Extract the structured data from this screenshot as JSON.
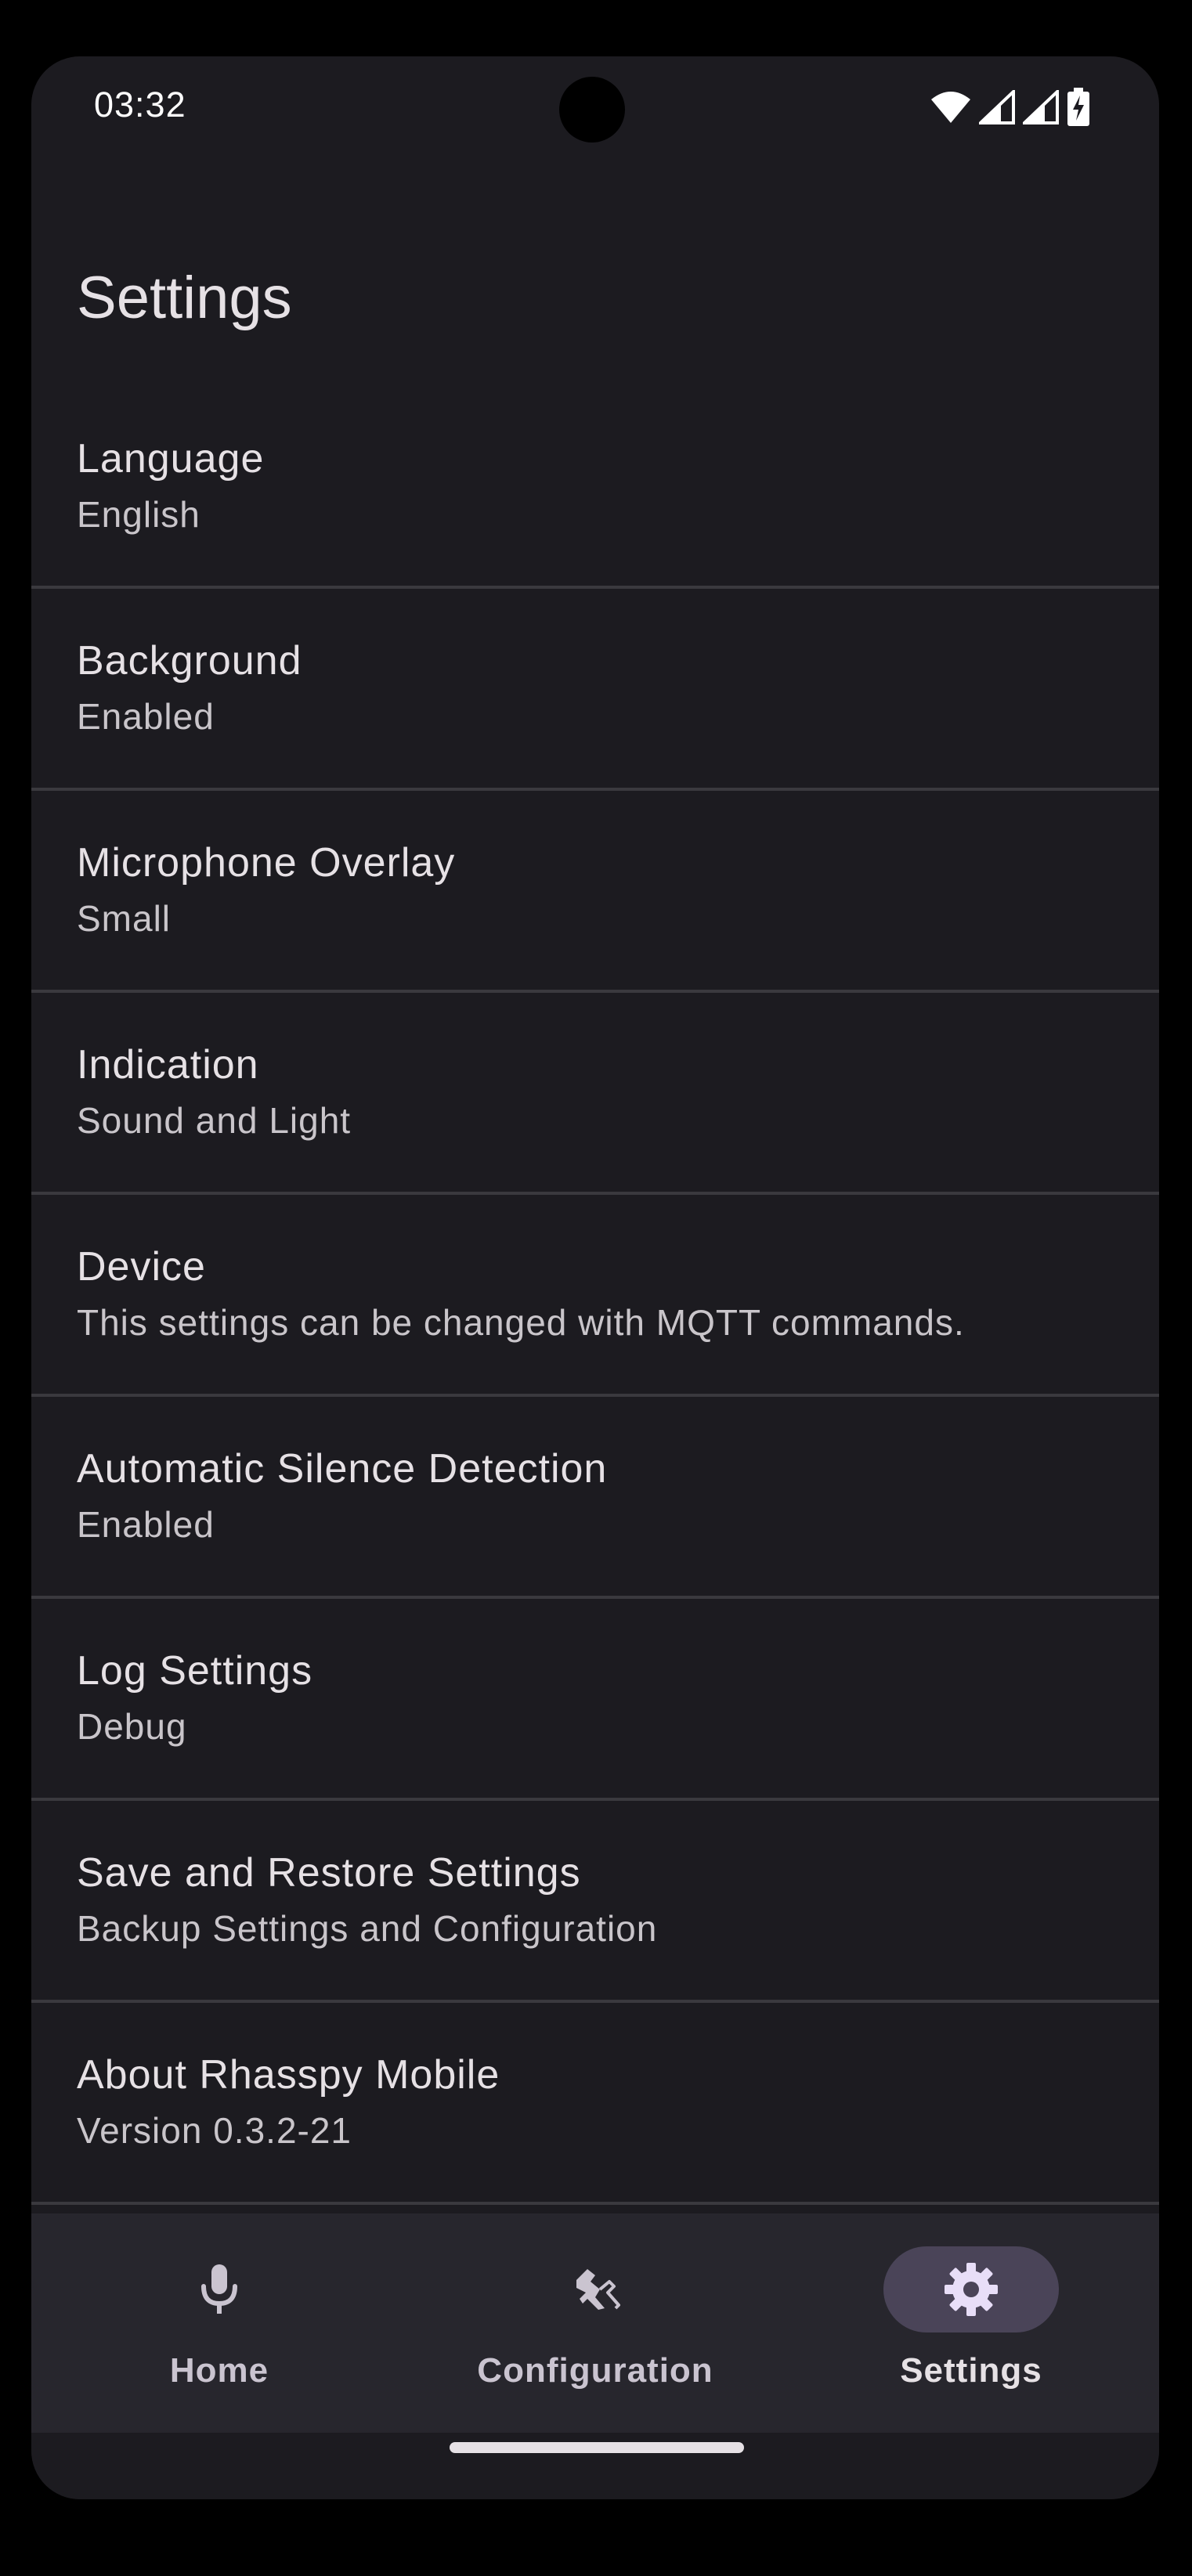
{
  "status_bar": {
    "time": "03:32",
    "icons": [
      "wifi-icon",
      "signal-icon",
      "signal-icon",
      "battery-charging-icon"
    ]
  },
  "app_bar": {
    "title": "Settings"
  },
  "settings_items": [
    {
      "title": "Language",
      "subtitle": "English"
    },
    {
      "title": "Background",
      "subtitle": "Enabled"
    },
    {
      "title": "Microphone Overlay",
      "subtitle": "Small"
    },
    {
      "title": "Indication",
      "subtitle": "Sound and Light"
    },
    {
      "title": "Device",
      "subtitle": "This settings can be changed with MQTT commands."
    },
    {
      "title": "Automatic Silence Detection",
      "subtitle": "Enabled"
    },
    {
      "title": "Log Settings",
      "subtitle": "Debug"
    },
    {
      "title": "Save and Restore Settings",
      "subtitle": "Backup Settings and Configuration"
    },
    {
      "title": "About Rhasspy Mobile",
      "subtitle": "Version 0.3.2-21"
    }
  ],
  "bottom_nav": {
    "items": [
      {
        "label": "Home",
        "icon": "microphone-icon",
        "active": false
      },
      {
        "label": "Configuration",
        "icon": "configuration-icon",
        "active": false
      },
      {
        "label": "Settings",
        "icon": "gear-icon",
        "active": true
      }
    ]
  },
  "colors": {
    "background": "#1c1b20",
    "nav_background": "#27262d",
    "active_indicator": "#4a4458",
    "text_primary": "#e6e1e5",
    "text_secondary": "#c9c5ca",
    "divider": "#3a393e"
  }
}
